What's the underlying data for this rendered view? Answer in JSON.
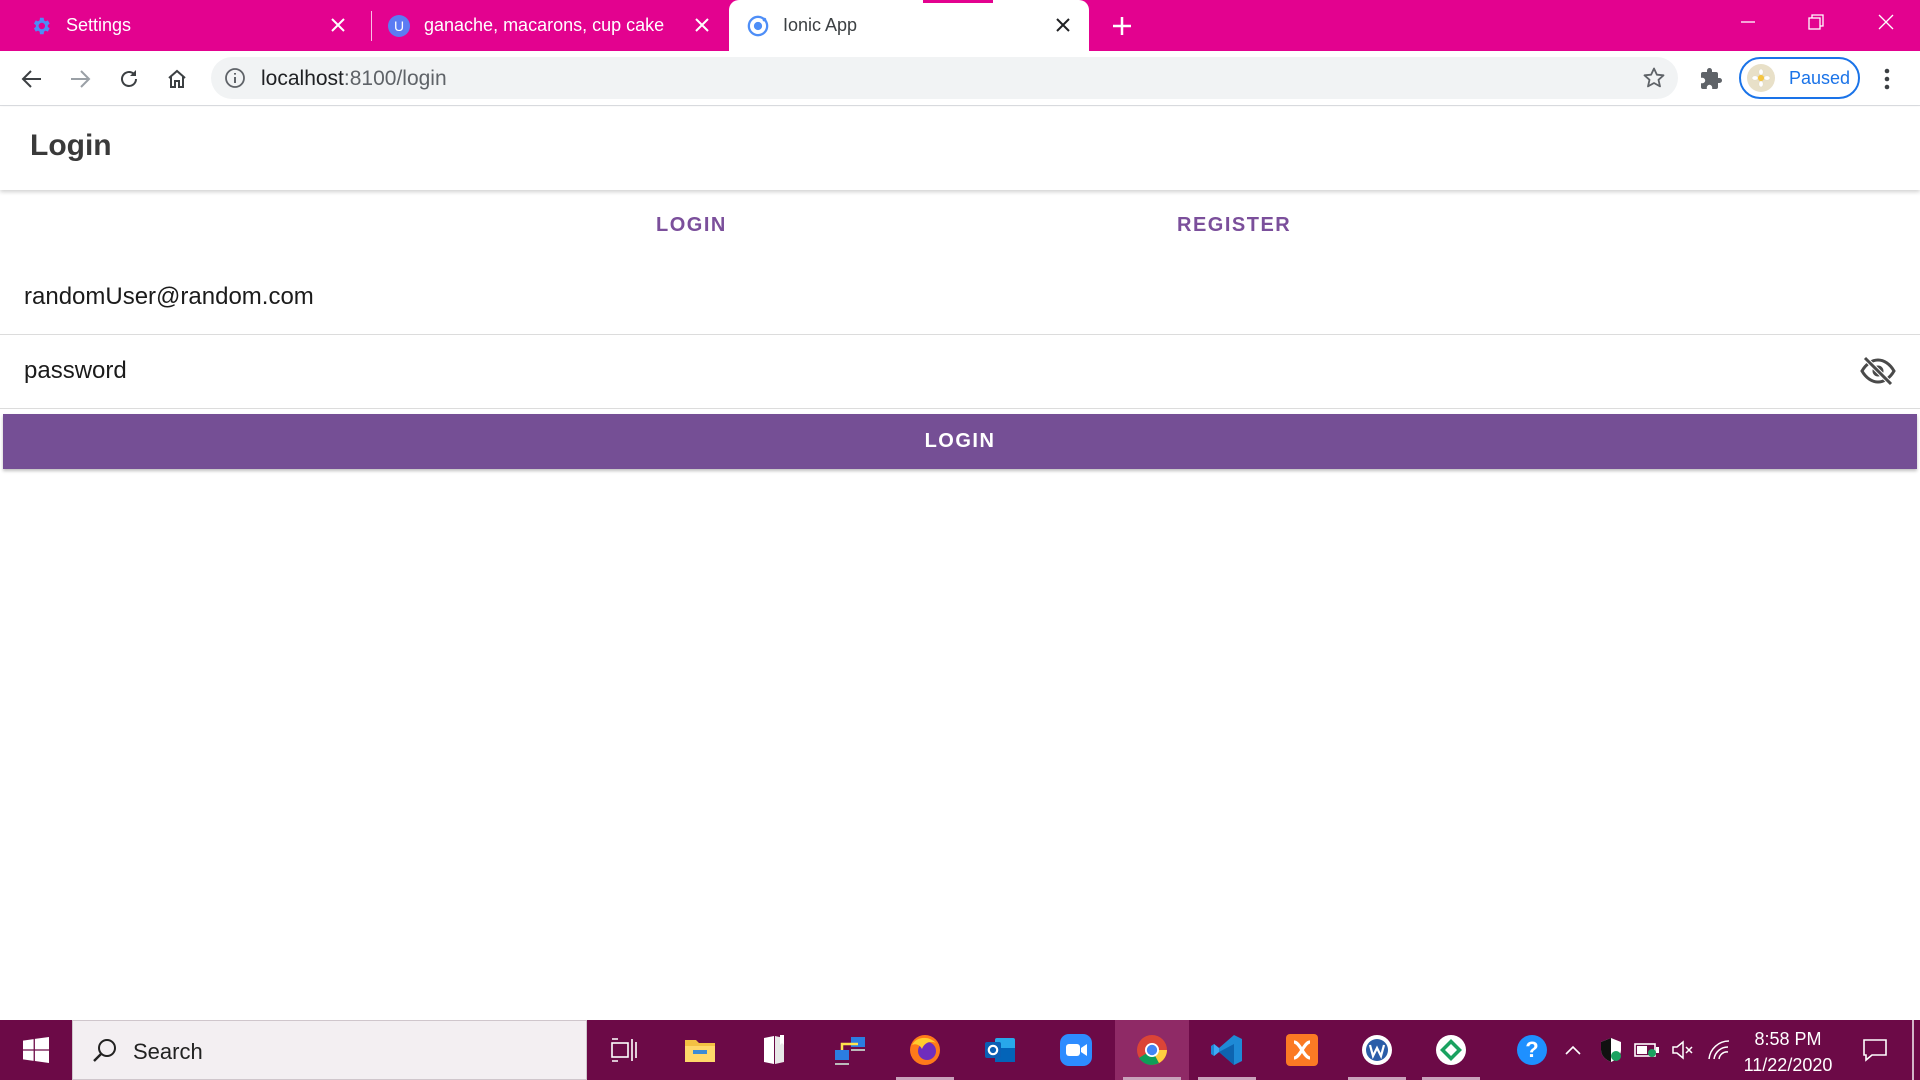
{
  "browser": {
    "tabs": [
      {
        "title": "Settings",
        "icon": "gear-icon"
      },
      {
        "title": "ganache, macarons, cup cake",
        "icon": "u-avatar-icon",
        "favicon_letter": "U"
      },
      {
        "title": "Ionic App",
        "icon": "ionic-icon",
        "active": true
      }
    ],
    "address": {
      "host": "localhost",
      "path": ":8100/login"
    },
    "profile_label": "Paused",
    "accent_color": "#e3028f"
  },
  "app": {
    "header_title": "Login",
    "segments": [
      "LOGIN",
      "REGISTER"
    ],
    "email_value": "randomUser@random.com",
    "password_value": "password",
    "login_button": "LOGIN",
    "primary_color": "#754f95"
  },
  "taskbar": {
    "search_placeholder": "Search",
    "apps": [
      "task-view-icon",
      "file-explorer-icon",
      "books-icon",
      "network-icon",
      "firefox-icon",
      "outlook-icon",
      "zoom-icon",
      "chrome-icon",
      "vscode-icon",
      "xampp-icon",
      "app-w-icon",
      "app-green-icon"
    ],
    "time": "8:58 PM",
    "date": "11/22/2020"
  }
}
